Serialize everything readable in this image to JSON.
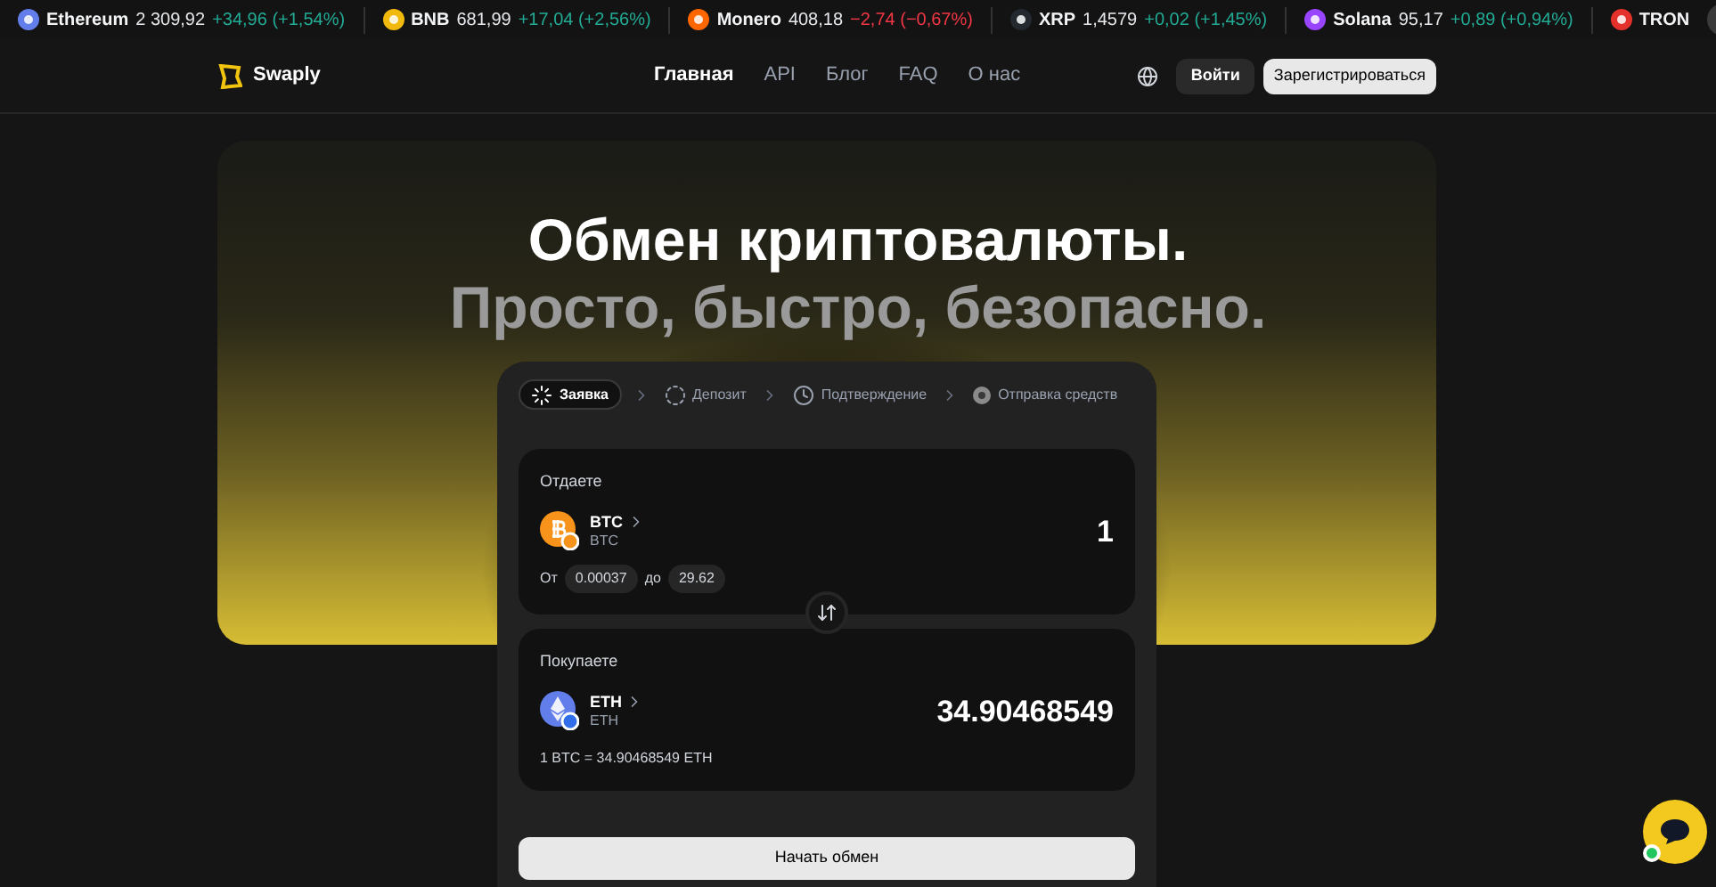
{
  "ticker": [
    {
      "name": "Ethereum",
      "price": "2 309,92",
      "change": "+34,96 (+1,54%)",
      "kind": "up",
      "color": "#627eea"
    },
    {
      "name": "BNB",
      "price": "681,99",
      "change": "+17,04 (+2,56%)",
      "kind": "up",
      "color": "#f0b90b"
    },
    {
      "name": "Monero",
      "price": "408,18",
      "change": "−2,74 (−0,67%)",
      "kind": "down",
      "color": "#ff6600"
    },
    {
      "name": "XRP",
      "price": "1,4579",
      "change": "+0,02 (+1,45%)",
      "kind": "up",
      "color": "#23292f"
    },
    {
      "name": "Solana",
      "price": "95,17",
      "change": "+0,89 (+0,94%)",
      "kind": "up",
      "color": "#9945ff"
    },
    {
      "name": "TRON",
      "color": "#e5312b"
    }
  ],
  "nav": {
    "brand": "Swaply",
    "links": [
      {
        "label": "Главная",
        "selected": true
      },
      {
        "label": "API",
        "selected": false
      },
      {
        "label": "Блог",
        "selected": false
      },
      {
        "label": "FAQ",
        "selected": false
      },
      {
        "label": "О нас",
        "selected": false
      }
    ],
    "login": "Войти",
    "register": "Зарегистрироваться"
  },
  "hero": {
    "title": "Обмен криптовалюты.",
    "subtitle": "Просто, быстро, безопасно."
  },
  "steps": [
    {
      "label": "Заявка",
      "kind": "spinner",
      "selected": true
    },
    {
      "label": "Депозит",
      "kind": "pending",
      "selected": false
    },
    {
      "label": "Подтверждение",
      "kind": "clock",
      "selected": false
    },
    {
      "label": "Отправка средств",
      "kind": "coin",
      "selected": false
    }
  ],
  "give": {
    "label": "Отдаете",
    "coin": "BTC",
    "network": "BTC",
    "amount": "1",
    "kind": "btc",
    "range_from_label": "От",
    "min": "0.00037",
    "range_to_label": "до",
    "max": "29.62"
  },
  "get": {
    "label": "Покупаете",
    "coin": "ETH",
    "network": "ETH",
    "amount": "34.90468549",
    "kind": "eth",
    "rate": "1 BTC = 34.90468549 ETH"
  },
  "submit": "Начать обмен"
}
